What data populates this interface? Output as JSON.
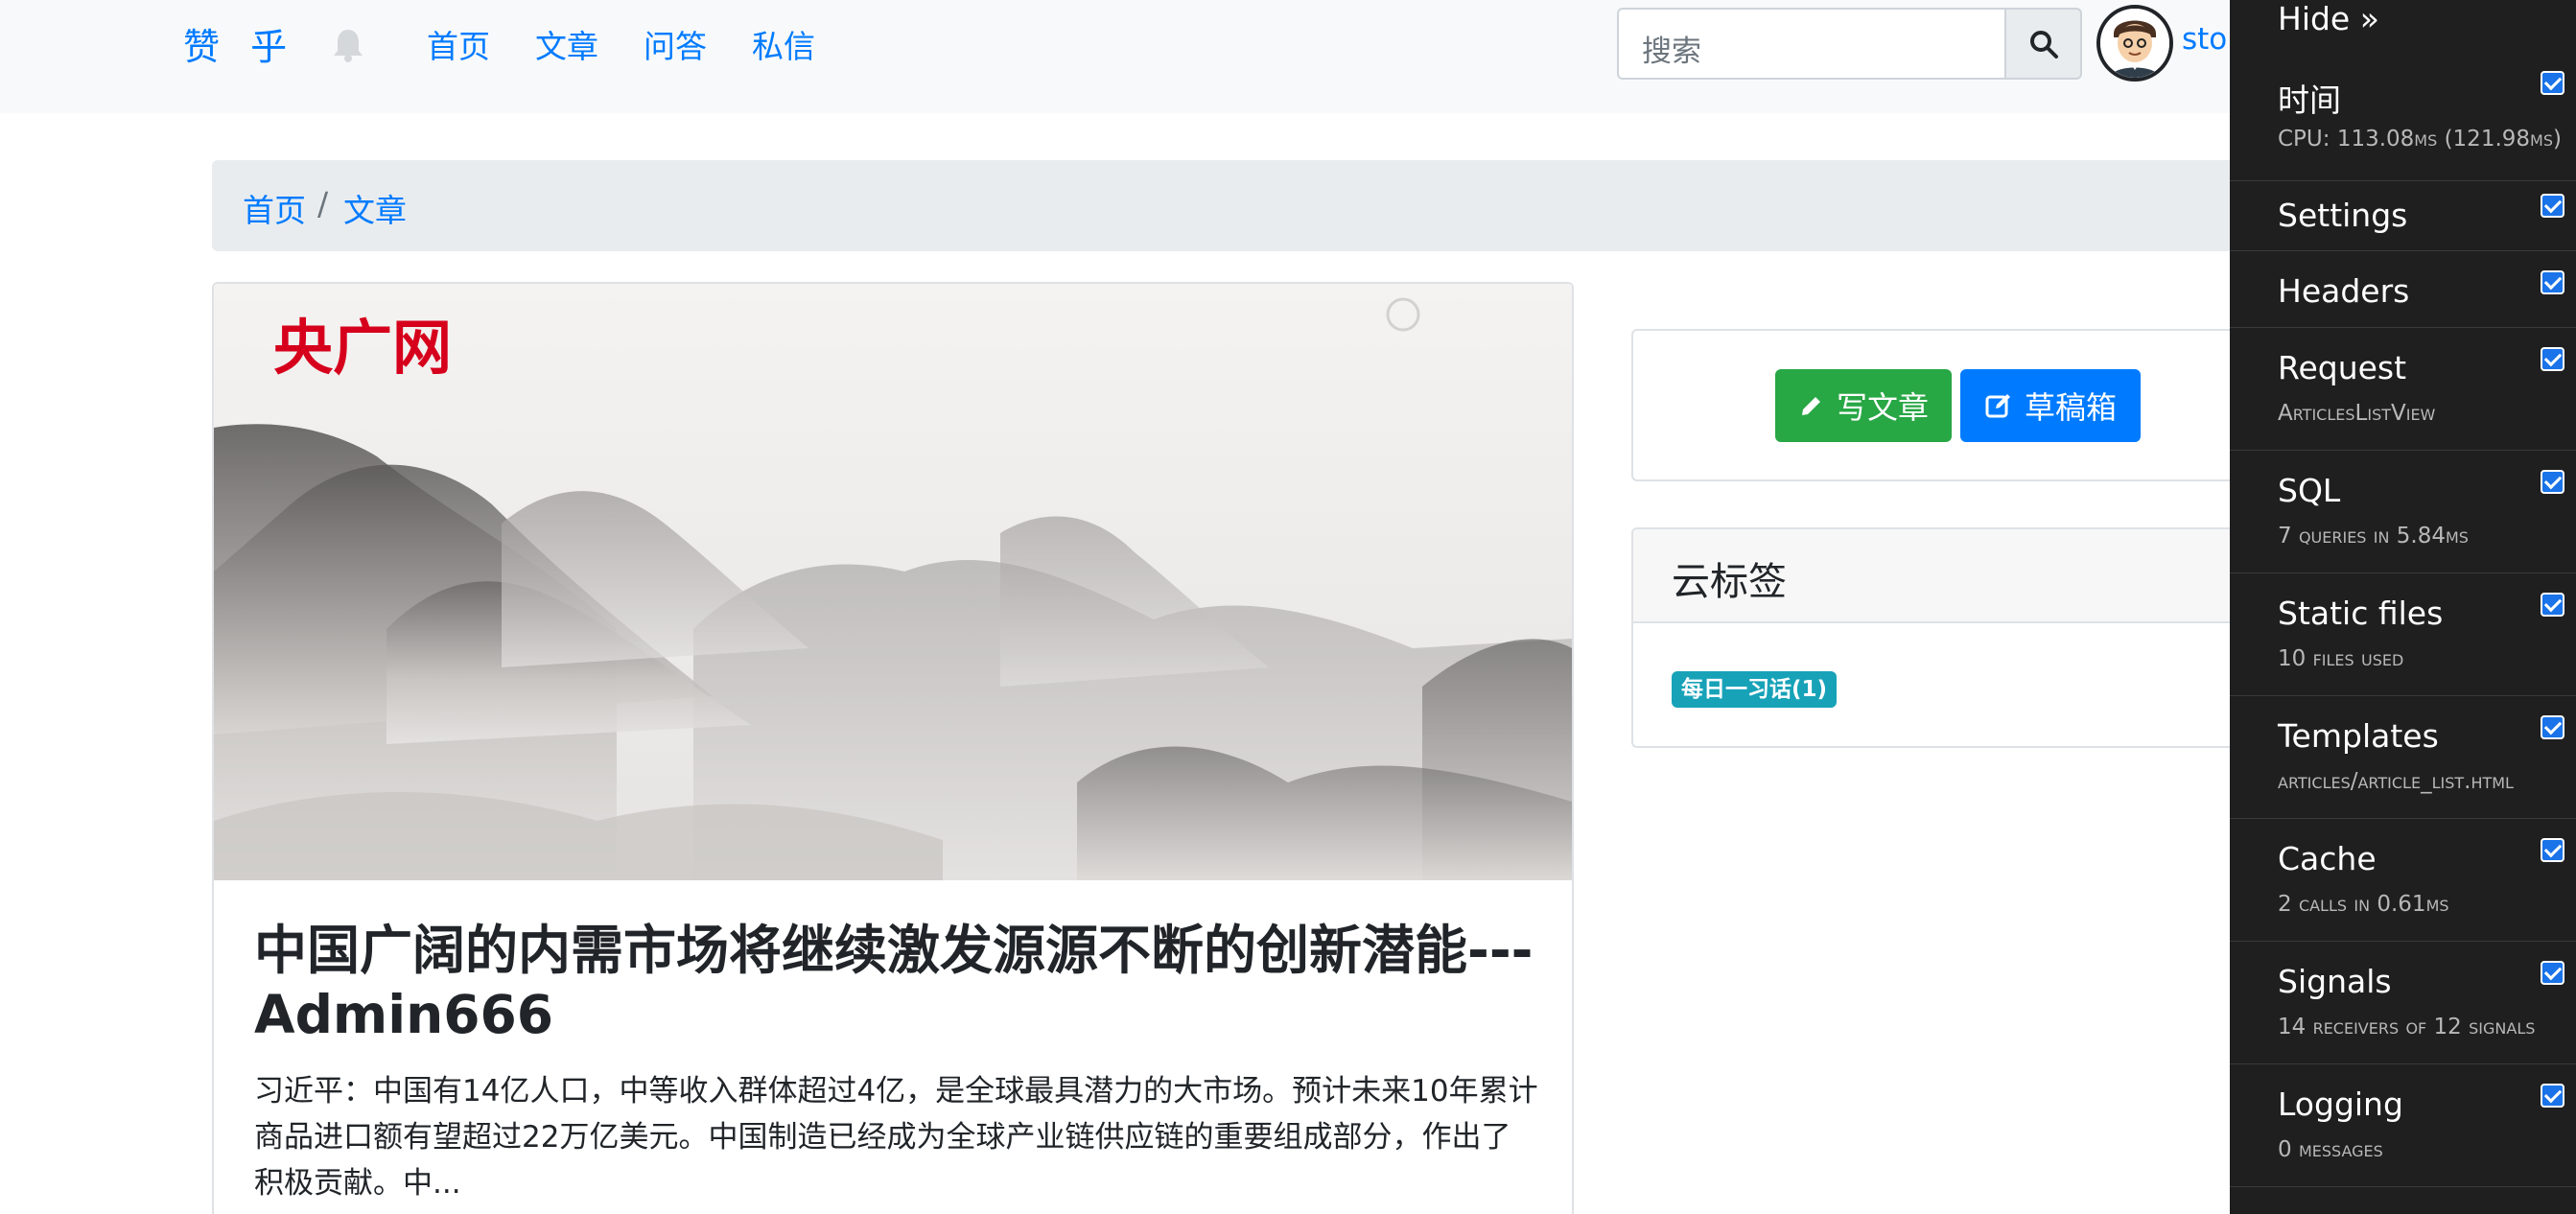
{
  "navbar": {
    "brand": "赞 乎",
    "links": [
      "首页",
      "文章",
      "问答",
      "私信"
    ],
    "search_placeholder": "搜索",
    "username": "storm"
  },
  "breadcrumb": {
    "home": "首页",
    "separator": "/",
    "current": "文章"
  },
  "article": {
    "image_watermark": "央广网",
    "title": "中国广阔的内需市场将继续激发源源不断的创新潜能---Admin666",
    "excerpt": "习近平：中国有14亿人口，中等收入群体超过4亿，是全球最具潜力的大市场。预计未来10年累计商品进口额有望超过22万亿美元。中国制造已经成为全球产业链供应链的重要组成部分，作出了积极贡献。中..."
  },
  "sidebar": {
    "write_button": "写文章",
    "drafts_button": "草稿箱",
    "tags_header": "云标签",
    "tags": [
      "每日一习话(1)"
    ]
  },
  "debug_toolbar": {
    "hide_label": "Hide »",
    "panels": [
      {
        "title": "时间",
        "subtitle": "CPU: 113.08ms (121.98ms)"
      },
      {
        "title": "Settings",
        "subtitle": ""
      },
      {
        "title": "Headers",
        "subtitle": ""
      },
      {
        "title": "Request",
        "subtitle": "ArticlesListView"
      },
      {
        "title": "SQL",
        "subtitle": "7 queries in 5.84ms"
      },
      {
        "title": "Static files",
        "subtitle": "10 files used"
      },
      {
        "title": "Templates",
        "subtitle": "articles/article_list.html"
      },
      {
        "title": "Cache",
        "subtitle": "2 calls in 0.61ms"
      },
      {
        "title": "Signals",
        "subtitle": "14 receivers of 12 signals"
      },
      {
        "title": "Logging",
        "subtitle": "0 messages"
      }
    ]
  },
  "colors": {
    "primary": "#007bff",
    "success": "#28a745",
    "info": "#17a2b8",
    "watermark_red": "#d6001c",
    "toolbar_bg": "#1f1f1f"
  }
}
